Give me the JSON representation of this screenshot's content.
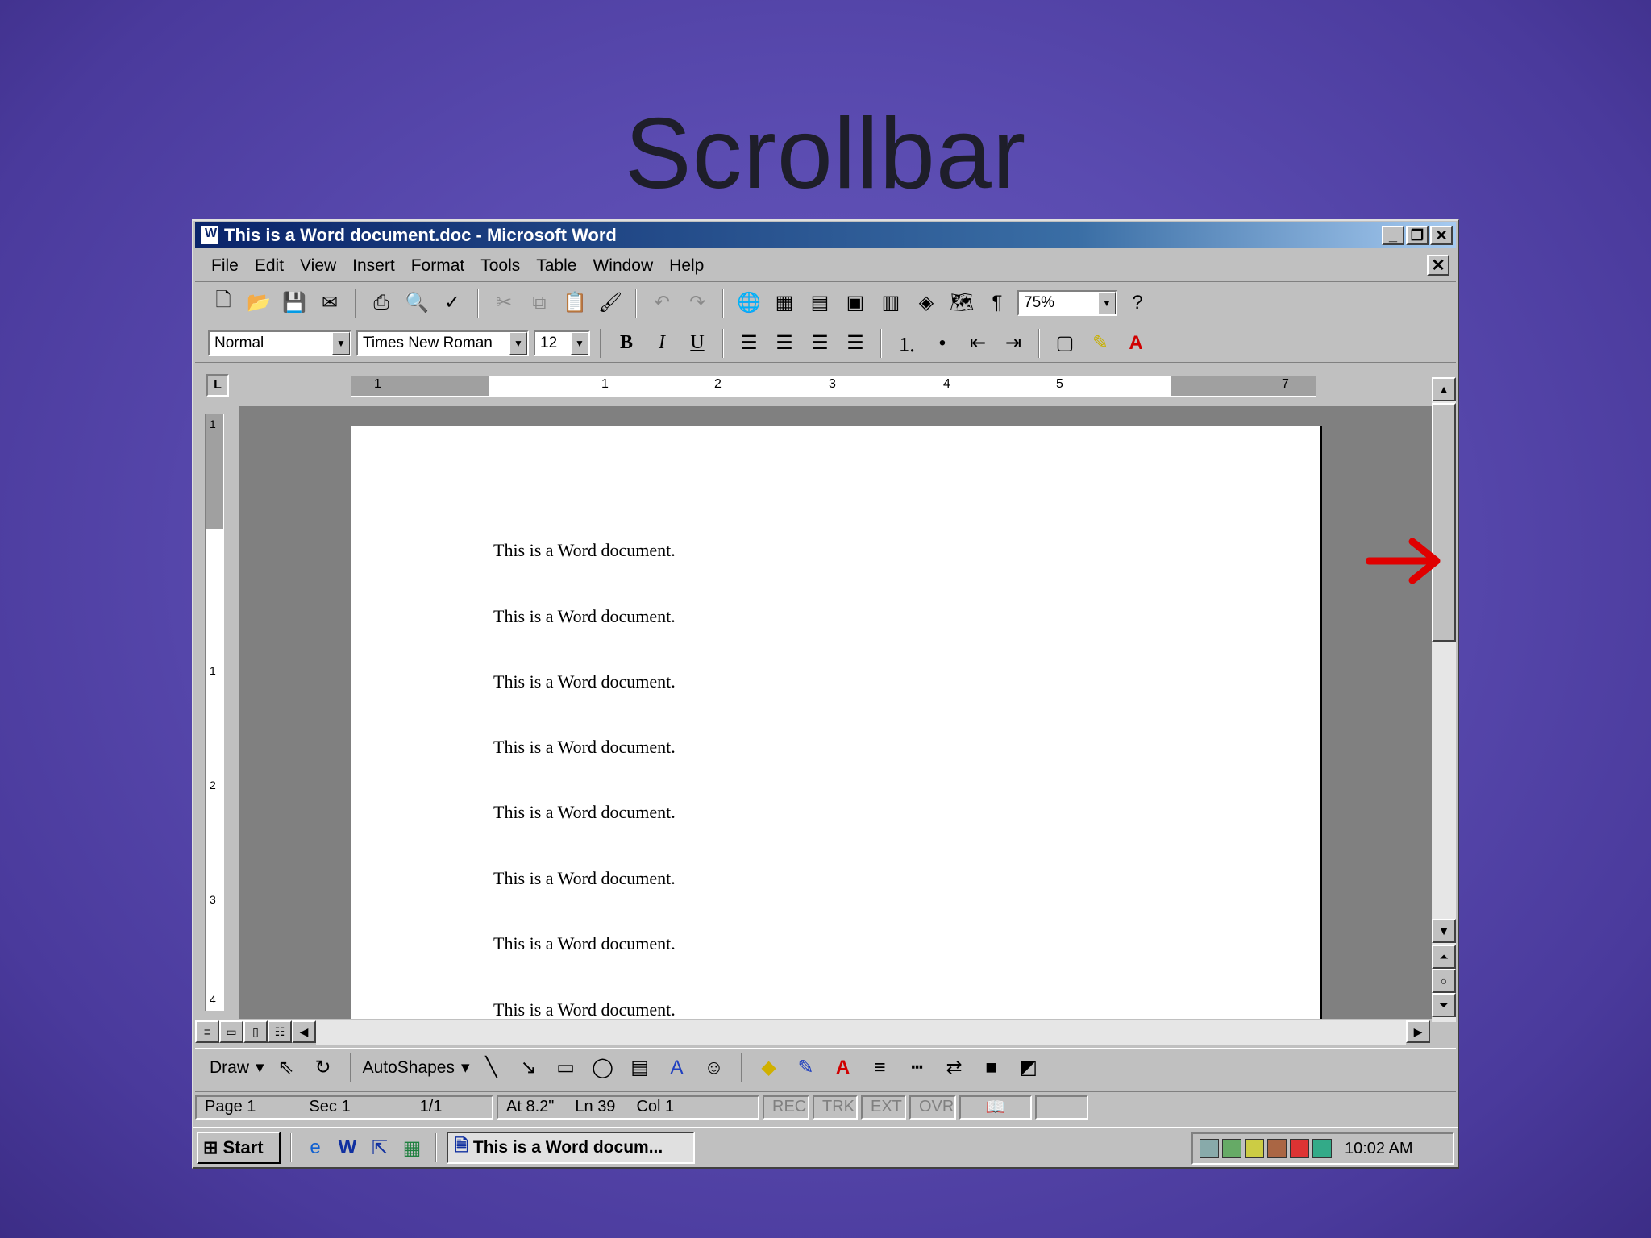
{
  "slide": {
    "title": "Scrollbar"
  },
  "window": {
    "title": "This is a Word document.doc - Microsoft Word",
    "buttons": {
      "minimize": "_",
      "restore": "❐",
      "close": "✕"
    }
  },
  "menu": [
    "File",
    "Edit",
    "View",
    "Insert",
    "Format",
    "Tools",
    "Table",
    "Window",
    "Help"
  ],
  "toolbar": {
    "zoom": "75%"
  },
  "formatting": {
    "style": "Normal",
    "font": "Times New Roman",
    "size": "12"
  },
  "ruler": {
    "numbers": [
      "1",
      "1",
      "2",
      "3",
      "4",
      "5",
      "7"
    ]
  },
  "vruler": {
    "numbers": [
      "1",
      "1",
      "2",
      "3",
      "4"
    ]
  },
  "document": {
    "lines": [
      "This is a Word document.",
      "This is a Word document.",
      "This is a Word document.",
      "This is a Word document.",
      "This is a Word document.",
      "This is a Word document.",
      "This is a Word document.",
      "This is a Word document."
    ]
  },
  "drawbar": {
    "draw": "Draw",
    "autoshapes": "AutoShapes"
  },
  "status": {
    "page": "Page",
    "page_val": "1",
    "sec": "Sec",
    "sec_val": "1",
    "pages": "1/1",
    "at": "At",
    "at_val": "8.2\"",
    "ln": "Ln",
    "ln_val": "39",
    "col": "Col",
    "col_val": "1",
    "rec": "REC",
    "trk": "TRK",
    "ext": "EXT",
    "ovr": "OVR"
  },
  "taskbar": {
    "start": "Start",
    "task": "This is a Word docum...",
    "clock": "10:02 AM"
  },
  "colors": {
    "title_active": "#0a246a",
    "arrow": "#e00000",
    "background": "#5a4bb0"
  }
}
